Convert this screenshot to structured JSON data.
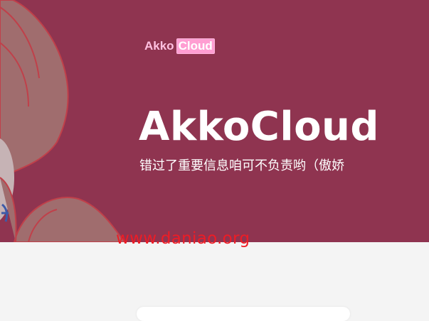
{
  "header": {
    "logo": {
      "part1": "Akko",
      "part2": "Cloud"
    }
  },
  "hero": {
    "title": "AkkoCloud",
    "subtitle": "错过了重要信息咱可不负责哟（傲娇"
  },
  "watermark": {
    "text": "www.daniao.org"
  },
  "colors": {
    "hero_background": "#8f3450",
    "logo_pink": "#ff9ed2",
    "watermark_red": "#ee1c25",
    "page_background": "#f4f4f4"
  },
  "icons": {
    "illustration": "anime-character-illustration"
  }
}
